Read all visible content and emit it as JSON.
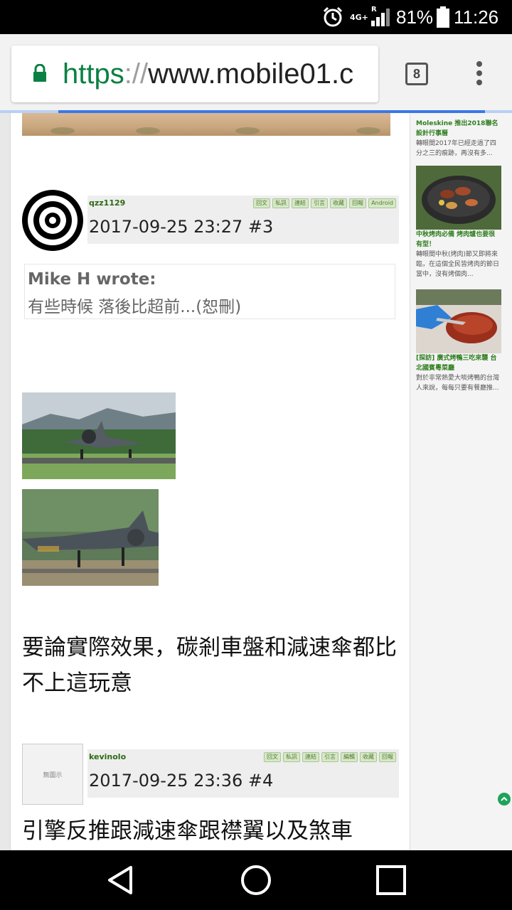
{
  "status_bar": {
    "network": "4G+",
    "signal_label": "R",
    "battery": "81%",
    "time": "11:26"
  },
  "browser": {
    "url_scheme": "https",
    "url_sep": "://",
    "url_host": "www.mobile01.c",
    "tab_count": "8"
  },
  "posts": [
    {
      "username": "qzz1129",
      "actions": [
        "回文",
        "私訊",
        "連結",
        "引言",
        "收藏",
        "回報",
        "Android"
      ],
      "date_floor": "2017-09-25 23:27  #3",
      "quote_author": "Mike H wrote:",
      "quote_text": "有些時候 落後比超前...(恕刪)",
      "body": "要論實際效果，碳剎車盤和減速傘都比不上這玩意"
    },
    {
      "username": "kevinolo",
      "avatar_text": "無圖示",
      "actions": [
        "回文",
        "私訊",
        "連結",
        "引言",
        "編輯",
        "收藏",
        "回報"
      ],
      "date_floor": "2017-09-25 23:36  #4",
      "body": "引擎反推跟減速傘跟襟翼以及煞車"
    }
  ],
  "sidebar": {
    "cards": [
      {
        "title": "Moleskine 推出2018聯名設計行事曆",
        "desc": "轉眼間2017年已經走過了四分之三的痕跡，再沒有多..."
      },
      {
        "title": "中秋烤肉必備 烤肉爐也要很有型！",
        "desc": "轉眼間中秋(烤肉)節又即將來臨，在這個全民皆烤肉的節日當中，沒有烤個肉..."
      },
      {
        "title": "[探訪] 廣式烤鴨三吃來襲 台北國賓粵菜廳",
        "desc": "對於非常熱愛大啖烤鴨的台灣人來說，每每只要有餐廳推..."
      }
    ]
  }
}
